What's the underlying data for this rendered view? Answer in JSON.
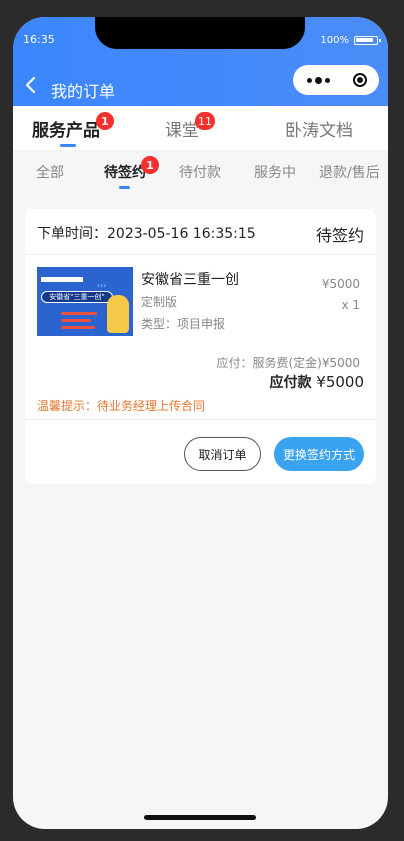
{
  "status_bar": {
    "time": "16:35",
    "battery": "100%"
  },
  "nav": {
    "title": "我的订单"
  },
  "tabs": [
    {
      "label": "服务产品",
      "badge": "1"
    },
    {
      "label": "课堂",
      "badge": "11"
    },
    {
      "label": "卧涛文档",
      "badge": ""
    }
  ],
  "subtabs": [
    {
      "label": "全部"
    },
    {
      "label": "待签约",
      "badge": "1"
    },
    {
      "label": "待付款"
    },
    {
      "label": "服务中"
    },
    {
      "label": "退款/售后"
    }
  ],
  "order": {
    "time_label": "下单时间：2023-05-16 16:35:15",
    "status": "待签约",
    "thumbnail_text": "安徽省\"三重一创\"",
    "product_name": "安徽省三重一创",
    "spec": "定制版",
    "type": "类型：项目申报",
    "price": "¥5000",
    "quantity": "x 1",
    "payable_note": "应付：服务费(定金)¥5000",
    "payable_label": "应付款",
    "payable_amount": "¥5000",
    "tip": "温馨提示：待业务经理上传合同",
    "cancel_label": "取消订单",
    "change_label": "更换签约方式"
  },
  "colors": {
    "brand": "#3b86ff",
    "badge": "#f5302d",
    "tip": "#e8772f",
    "button": "#3aa3f0"
  }
}
